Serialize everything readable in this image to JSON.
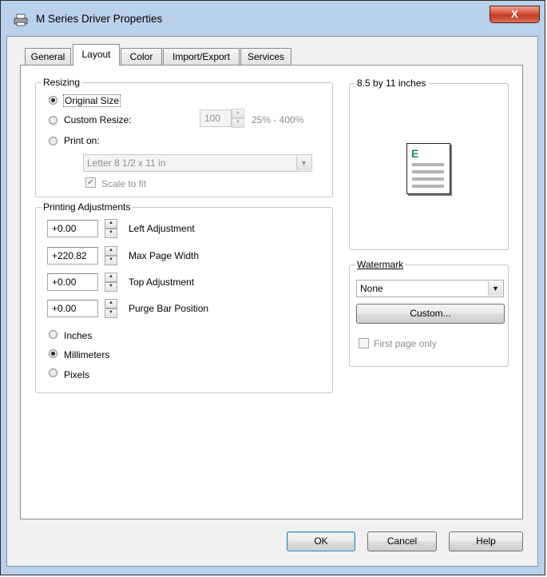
{
  "window": {
    "title": "M Series Driver Properties",
    "close_label": "X"
  },
  "tabs": [
    {
      "label": "General"
    },
    {
      "label": "Layout"
    },
    {
      "label": "Color"
    },
    {
      "label": "Import/Export"
    },
    {
      "label": "Services"
    }
  ],
  "resizing": {
    "group_label": "Resizing",
    "original_size_label": "Original Size",
    "custom_resize_label": "Custom Resize:",
    "custom_resize_value": "100",
    "custom_resize_range": "25% - 400%",
    "print_on_label": "Print on:",
    "paper_selected": "Letter 8 1/2 x 11 in",
    "scale_to_fit_label": "Scale to fit"
  },
  "printing": {
    "group_label": "Printing Adjustments",
    "rows": [
      {
        "value": "+0.00",
        "label": "Left Adjustment"
      },
      {
        "value": "+220.82",
        "label": "Max Page Width"
      },
      {
        "value": "+0.00",
        "label": "Top Adjustment"
      },
      {
        "value": "+0.00",
        "label": "Purge Bar Position"
      }
    ],
    "units": [
      {
        "label": "Inches",
        "checked": false
      },
      {
        "label": "Millimeters",
        "checked": true
      },
      {
        "label": "Pixels",
        "checked": false
      }
    ]
  },
  "preview": {
    "group_label": "8.5 by 11 inches",
    "page_letter": "E"
  },
  "watermark": {
    "group_label": "Watermark",
    "selected": "None",
    "custom_label": "Custom...",
    "first_page_label": "First page only"
  },
  "footer": {
    "ok_label": "OK",
    "cancel_label": "Cancel",
    "help_label": "Help"
  }
}
